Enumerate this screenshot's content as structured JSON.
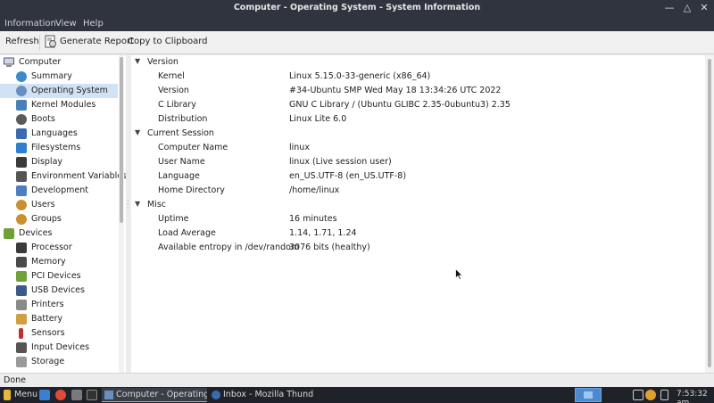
{
  "window": {
    "title": "Computer - Operating System - System Information"
  },
  "menubar": [
    "Information",
    "View",
    "Help"
  ],
  "toolbar": {
    "refresh": "Refresh",
    "generate_report": "Generate Report",
    "copy_clipboard": "Copy to Clipboard"
  },
  "tree": {
    "computer": {
      "label": "Computer",
      "items": [
        {
          "label": "Summary",
          "icon": "info-icon",
          "color": "#3b8ad0"
        },
        {
          "label": "Operating System",
          "icon": "os-icon",
          "color": "#6a8fbf"
        },
        {
          "label": "Kernel Modules",
          "icon": "kernel-icon",
          "color": "#4a7fb8"
        },
        {
          "label": "Boots",
          "icon": "boot-icon",
          "color": "#5a5a5a"
        },
        {
          "label": "Languages",
          "icon": "flag-icon",
          "color": "#3a6ab0"
        },
        {
          "label": "Filesystems",
          "icon": "filesystem-icon",
          "color": "#2f7fd0"
        },
        {
          "label": "Display",
          "icon": "monitor-icon",
          "color": "#3a3a3a"
        },
        {
          "label": "Environment Variables",
          "icon": "terminal-icon",
          "color": "#555555"
        },
        {
          "label": "Development",
          "icon": "development-icon",
          "color": "#4d7fc0"
        },
        {
          "label": "Users",
          "icon": "user-icon",
          "color": "#c8902f"
        },
        {
          "label": "Groups",
          "icon": "group-icon",
          "color": "#c8902f"
        }
      ]
    },
    "devices": {
      "label": "Devices",
      "items": [
        {
          "label": "Processor",
          "icon": "cpu-icon",
          "color": "#3a3a3a"
        },
        {
          "label": "Memory",
          "icon": "memory-icon",
          "color": "#4a4a4a"
        },
        {
          "label": "PCI Devices",
          "icon": "pci-icon",
          "color": "#6fa03a"
        },
        {
          "label": "USB Devices",
          "icon": "usb-icon",
          "color": "#3a5a8a"
        },
        {
          "label": "Printers",
          "icon": "printer-icon",
          "color": "#8a8a8a"
        },
        {
          "label": "Battery",
          "icon": "battery-icon",
          "color": "#d0a040"
        },
        {
          "label": "Sensors",
          "icon": "thermometer-icon",
          "color": "#c03030"
        },
        {
          "label": "Input Devices",
          "icon": "keyboard-icon",
          "color": "#555555"
        },
        {
          "label": "Storage",
          "icon": "storage-icon",
          "color": "#9a9a9a"
        }
      ]
    }
  },
  "sections": [
    {
      "title": "Version",
      "rows": [
        {
          "key": "Kernel",
          "value": "Linux 5.15.0-33-generic (x86_64)"
        },
        {
          "key": "Version",
          "value": "#34-Ubuntu SMP Wed May 18 13:34:26 UTC 2022"
        },
        {
          "key": "C Library",
          "value": "GNU C Library / (Ubuntu GLIBC 2.35-0ubuntu3) 2.35"
        },
        {
          "key": "Distribution",
          "value": "Linux Lite 6.0"
        }
      ]
    },
    {
      "title": "Current Session",
      "rows": [
        {
          "key": "Computer Name",
          "value": "linux"
        },
        {
          "key": "User Name",
          "value": "linux (Live session user)"
        },
        {
          "key": "Language",
          "value": "en_US.UTF-8 (en_US.UTF-8)"
        },
        {
          "key": "Home Directory",
          "value": "/home/linux"
        }
      ]
    },
    {
      "title": "Misc",
      "rows": [
        {
          "key": "Uptime",
          "value": "16 minutes"
        },
        {
          "key": "Load Average",
          "value": "1.14, 1.71, 1.24"
        },
        {
          "key": "Available entropy in /dev/random",
          "value": "3076 bits (healthy)"
        }
      ]
    }
  ],
  "status": "Done",
  "taskbar": {
    "menu": "Menu",
    "tasks": [
      {
        "label": "Computer - Operating ...",
        "active": true
      },
      {
        "label": "Inbox - Mozilla Thund...",
        "active": false
      }
    ],
    "clock": "7:53:32 am"
  },
  "colors": {
    "selection": "#cfe3f5",
    "titlebar": "#2f343f",
    "taskbar": "#1f2329",
    "accent": "#4a8ad0"
  }
}
